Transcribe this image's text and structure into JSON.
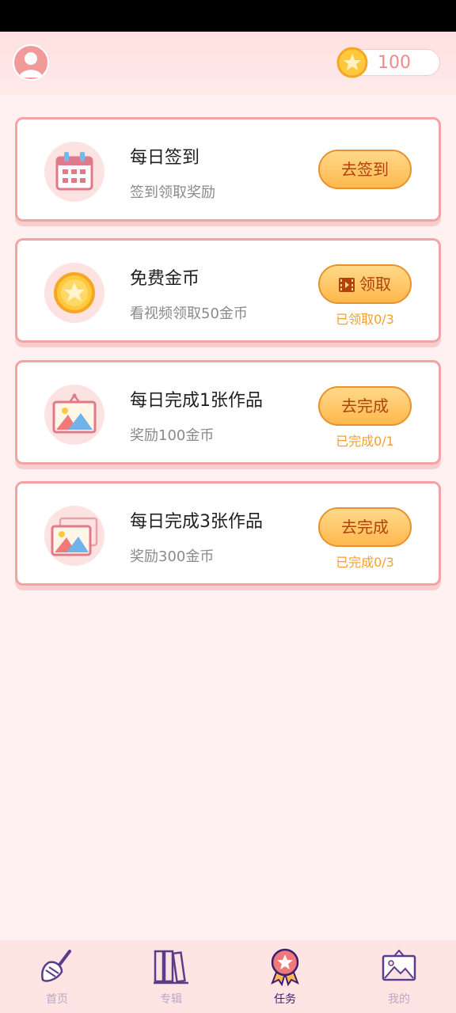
{
  "header": {
    "avatar_icon": "user-avatar-icon",
    "coins": "100",
    "coin_icon": "star-coin-icon"
  },
  "tasks": [
    {
      "icon": "calendar-icon",
      "title": "每日签到",
      "subtitle": "签到领取奖励",
      "button": "去签到",
      "progress": ""
    },
    {
      "icon": "gold-coin-icon",
      "title": "免费金币",
      "subtitle": "看视频领取50金币",
      "button": "领取",
      "button_icon": "video-icon",
      "progress": "已领取0/3"
    },
    {
      "icon": "picture-icon",
      "title": "每日完成1张作品",
      "subtitle": "奖励100金币",
      "button": "去完成",
      "progress": "已完成0/1"
    },
    {
      "icon": "pictures-stack-icon",
      "title": "每日完成3张作品",
      "subtitle": "奖励300金币",
      "button": "去完成",
      "progress": "已完成0/3"
    }
  ],
  "tabs": [
    {
      "label": "首页",
      "icon": "paint-brush-icon",
      "active": false
    },
    {
      "label": "专辑",
      "icon": "books-icon",
      "active": false
    },
    {
      "label": "任务",
      "icon": "medal-icon",
      "active": true
    },
    {
      "label": "我的",
      "icon": "framed-picture-icon",
      "active": false
    }
  ],
  "colors": {
    "accent": "#f2a3a3",
    "button_gradient_top": "#ffd98a",
    "button_gradient_bottom": "#ffb84d",
    "button_text": "#b0420e",
    "progress_text": "#f0a030",
    "tab_active": "#3b1f6e",
    "tab_inactive": "#b9a7c4"
  }
}
